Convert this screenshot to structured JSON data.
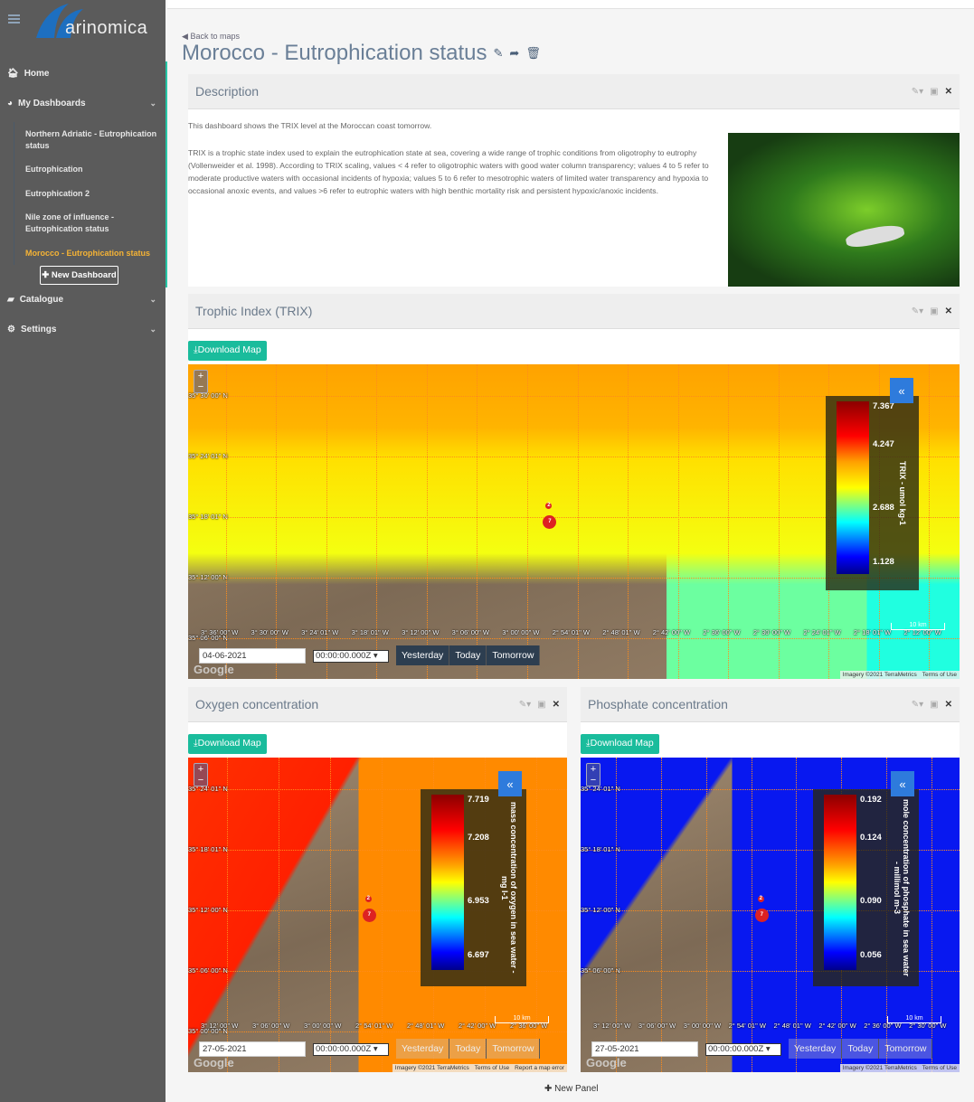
{
  "brand": {
    "logo_text": "arinomica"
  },
  "sidebar": {
    "items": [
      {
        "label": "Home"
      },
      {
        "label": "My Dashboards"
      },
      {
        "label": "Catalogue"
      },
      {
        "label": "Settings"
      }
    ],
    "dashboards": [
      {
        "label": "Northern Adriatic - Eutrophication status"
      },
      {
        "label": "Eutrophication"
      },
      {
        "label": "Eutrophication 2"
      },
      {
        "label": "Nile zone of influence - Eutrophication status"
      },
      {
        "label": "Morocco - Eutrophication status",
        "active": true
      }
    ],
    "new_dashboard": "New Dashboard"
  },
  "page": {
    "back": "Back to maps",
    "title": "Morocco - Eutrophication status",
    "new_panel": "New Panel"
  },
  "description": {
    "title": "Description",
    "p1": "This dashboard shows the TRIX level at the Moroccan coast tomorrow.",
    "p2": "TRIX is a trophic state index used to explain the eutrophication state at sea, covering a wide range of trophic conditions from oligotrophy to eutrophy (Vollenweider et al. 1998). According to TRIX scaling, values < 4 refer to oligotrophic waters with good water column transparency; values 4 to 5 refer to moderate productive waters with occasional incidents of hypoxia; values 5 to 6 refer to mesotrophic waters of limited water transparency and hypoxia to occasional anoxic events, and values >6 refer to eutrophic waters with high benthic mortality risk and persistent hypoxic/anoxic incidents."
  },
  "common": {
    "download": "Download Map",
    "google": "Google",
    "imagery": "Imagery ©2021 TerraMetrics",
    "terms": "Terms of Use",
    "report": "Report a map error",
    "scale": "10 km",
    "yesterday": "Yesterday",
    "today": "Today",
    "tomorrow": "Tomorrow",
    "zoom_in": "+",
    "zoom_out": "−",
    "collapse": "«"
  },
  "maps": [
    {
      "title": "Trophic Index (TRIX)",
      "date": "04-06-2021",
      "time": "00:00:00.000Z",
      "unit": "TRIX - umol kg-1",
      "legend": [
        "7.367",
        "4.247",
        "2.688",
        "1.128"
      ],
      "lat": [
        "35° 30' 00\" N",
        "35° 24' 01\" N",
        "35° 18' 01\" N",
        "35° 12' 00\" N",
        "35° 06' 00\" N"
      ],
      "lon": [
        "3° 36' 00\" W",
        "3° 30' 00\" W",
        "3° 24' 01\" W",
        "3° 18' 01\" W",
        "3° 12' 00\" W",
        "3° 06' 00\" W",
        "3° 00' 00\" W",
        "2° 54' 01\" W",
        "2° 48' 01\" W",
        "2° 42' 00\" W",
        "2° 36' 00\" W",
        "2° 30' 00\" W",
        "2° 24' 01\" W",
        "2° 18' 01\" W",
        "2° 12' 00\" W"
      ]
    },
    {
      "title": "Oxygen concentration",
      "date": "27-05-2021",
      "time": "00:00:00.000Z",
      "unit": "mass concentration of oxygen in sea water - mg l-1",
      "legend": [
        "7.719",
        "7.208",
        "6.953",
        "6.697"
      ],
      "lat": [
        "35° 24' 01\" N",
        "35° 18' 01\" N",
        "35° 12' 00\" N",
        "35° 06' 00\" N",
        "35° 00' 00\" N"
      ],
      "lon": [
        "3° 12' 00\" W",
        "3° 06' 00\" W",
        "3° 00' 00\" W",
        "2° 54' 01\" W",
        "2° 48' 01\" W",
        "2° 42' 00\" W",
        "2° 36' 00\" W"
      ]
    },
    {
      "title": "Phosphate concentration",
      "date": "27-05-2021",
      "time": "00:00:00.000Z",
      "unit": "mole concentration of phosphate in sea water - millimol m-3",
      "legend": [
        "0.192",
        "0.124",
        "0.090",
        "0.056"
      ],
      "lat": [
        "35° 24' 01\" N",
        "35° 18' 01\" N",
        "35° 12' 00\" N",
        "35° 06' 00\" N"
      ],
      "lon": [
        "3° 12' 00\" W",
        "3° 06' 00\" W",
        "3° 00' 00\" W",
        "2° 54' 01\" W",
        "2° 48' 01\" W",
        "2° 42' 00\" W",
        "2° 36' 00\" W",
        "2° 30' 00\" W"
      ]
    }
  ]
}
